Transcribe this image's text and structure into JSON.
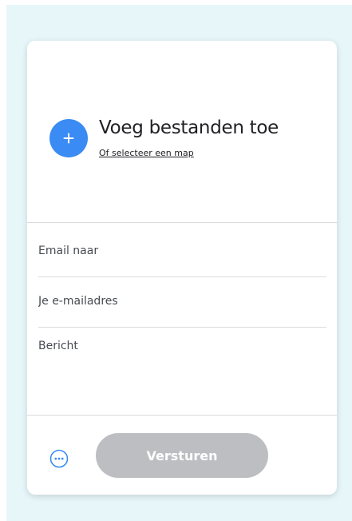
{
  "colors": {
    "background": "#e6f6f9",
    "card": "#ffffff",
    "accent": "#3a8bf3",
    "send_button_disabled": "#bcbec2",
    "divider": "#d9dbde"
  },
  "upload": {
    "add_icon": "plus-icon",
    "title": "Voeg bestanden toe",
    "select_folder_link": "Of selecteer een map"
  },
  "form": {
    "email_to_placeholder": "Email naar",
    "email_from_placeholder": "Je e-mailadres",
    "message_placeholder": "Bericht"
  },
  "footer": {
    "more_options_icon": "more-options-icon",
    "send_label": "Versturen"
  }
}
